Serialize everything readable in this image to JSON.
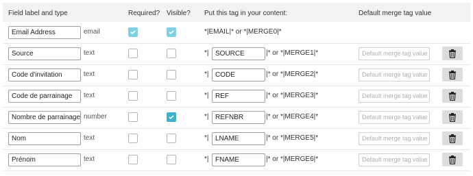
{
  "header": {
    "field_label": "Field label and type",
    "required": "Required?",
    "visible": "Visible?",
    "tag": "Put this tag in your content:",
    "default": "Default merge tag value"
  },
  "merge_prefix": "*|",
  "email_row": {
    "label": "Email Address",
    "type": "email",
    "required": true,
    "visible": true,
    "merge_text": "*|EMAIL|* or *|MERGE0|*"
  },
  "rows": [
    {
      "label": "Source",
      "type": "text",
      "required": false,
      "visible": false,
      "tag": "SOURCE",
      "merge_suffix": "|* or *|MERGE1|*",
      "default_placeholder": "Default merge tag value"
    },
    {
      "label": "Code d'invitation",
      "type": "text",
      "required": false,
      "visible": false,
      "tag": "CODE",
      "merge_suffix": "|* or *|MERGE2|*",
      "default_placeholder": "Default merge tag value"
    },
    {
      "label": "Code de parrainage",
      "type": "text",
      "required": false,
      "visible": false,
      "tag": "REF",
      "merge_suffix": "|* or *|MERGE3|*",
      "default_placeholder": "Default merge tag value"
    },
    {
      "label": "Nombre de parrainages",
      "type": "number",
      "required": false,
      "visible": true,
      "tag": "REFNBR",
      "merge_suffix": "|* or *|MERGE4|*",
      "default_placeholder": "Default merge tag value"
    },
    {
      "label": "Nom",
      "type": "text",
      "required": false,
      "visible": false,
      "tag": "LNAME",
      "merge_suffix": "|* or *|MERGE5|*",
      "default_placeholder": "Default merge tag value"
    },
    {
      "label": "Prénom",
      "type": "text",
      "required": false,
      "visible": false,
      "tag": "FNAME",
      "merge_suffix": "|* or *|MERGE6|*",
      "default_placeholder": "Default merge tag value"
    }
  ],
  "icons": {
    "delete": "trash-icon",
    "check": "checkmark-icon"
  },
  "colors": {
    "check_disabled": "#7ed0e2",
    "check_active": "#3ab3cf",
    "delete_button": "#dcdcdc"
  }
}
